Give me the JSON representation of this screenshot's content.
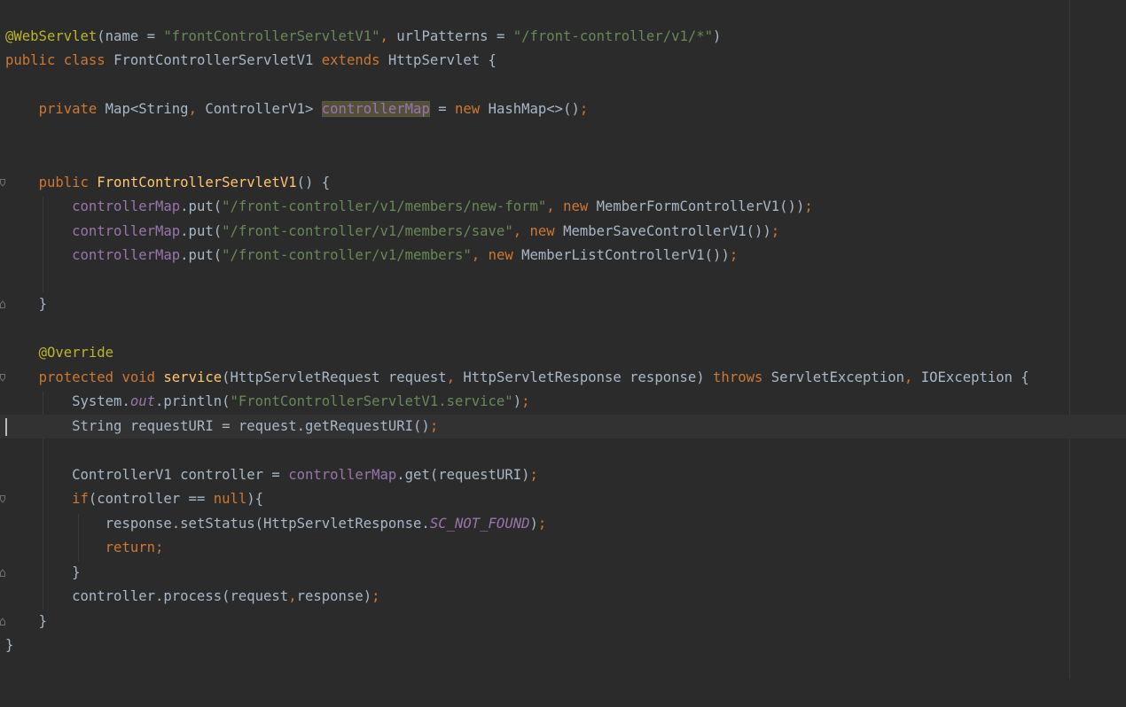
{
  "editor": {
    "language": "Java",
    "caret_line": 18,
    "highlighted_symbol": "controllerMap",
    "colors": {
      "background": "#2b2b2b",
      "current_line": "#323232",
      "default": "#a9b7c6",
      "keyword": "#cc7832",
      "string": "#6a8759",
      "annotation": "#bbb529",
      "field": "#9876aa",
      "method_decl": "#ffc66d",
      "usage_highlight": "#52503a"
    }
  },
  "code": {
    "l1": {
      "ann": "@WebServlet",
      "a": "(name = ",
      "s1": "\"frontControllerServletV1\"",
      "c1": ", ",
      "b": "urlPatterns = ",
      "s2": "\"/front-controller/v1/*\"",
      "d": ")"
    },
    "l2": {
      "k1": "public ",
      "k2": "class ",
      "a": "FrontControllerServletV1 ",
      "k3": "extends ",
      "b": "HttpServlet {"
    },
    "l4": {
      "k1": "private ",
      "a": "Map<String",
      "c1": ", ",
      "b": "ControllerV1> ",
      "f": "controllerMap",
      "c": " = ",
      "k2": "new ",
      "d": "HashMap<>()",
      "semi": ";"
    },
    "l7": {
      "k1": "public ",
      "fn": "FrontControllerServletV1",
      "a": "() {"
    },
    "l8": {
      "f": "controllerMap",
      "a": ".put(",
      "s": "\"/front-controller/v1/members/new-form\"",
      "c1": ", ",
      "k": "new ",
      "b": "MemberFormControllerV1())",
      "semi": ";"
    },
    "l9": {
      "f": "controllerMap",
      "a": ".put(",
      "s": "\"/front-controller/v1/members/save\"",
      "c1": ", ",
      "k": "new ",
      "b": "MemberSaveControllerV1())",
      "semi": ";"
    },
    "l10": {
      "f": "controllerMap",
      "a": ".put(",
      "s": "\"/front-controller/v1/members\"",
      "c1": ", ",
      "k": "new ",
      "b": "MemberListControllerV1())",
      "semi": ";"
    },
    "l12": {
      "a": "}"
    },
    "l14": {
      "ann": "@Override"
    },
    "l15": {
      "k1": "protected ",
      "k2": "void ",
      "fn": "service",
      "a": "(HttpServletRequest request",
      "c1": ", ",
      "b": "HttpServletResponse response) ",
      "k3": "throws ",
      "c": "ServletException",
      "c2": ", ",
      "d": "IOException {"
    },
    "l16": {
      "a": "System.",
      "fi": "out",
      "b": ".println(",
      "s": "\"FrontControllerServletV1.service\"",
      "c": ")",
      "semi": ";"
    },
    "l17": {
      "a": "String requestURI = request.getRequestURI()",
      "semi": ";"
    },
    "l19": {
      "a": "ControllerV1 controller = ",
      "f": "controllerMap",
      "b": ".get(requestURI)",
      "semi": ";"
    },
    "l20": {
      "k1": "if",
      "a": "(controller == ",
      "k2": "null",
      "b": "){"
    },
    "l21": {
      "a": "response.setStatus(HttpServletResponse.",
      "fi": "SC_NOT_FOUND",
      "b": ")",
      "semi": ";"
    },
    "l22": {
      "k": "return",
      "semi": ";"
    },
    "l23": {
      "a": "}"
    },
    "l24": {
      "a": "controller.process(request",
      "c1": ",",
      "b": "response)",
      "semi": ";"
    },
    "l25": {
      "a": "}"
    },
    "l26": {
      "a": "}"
    }
  }
}
